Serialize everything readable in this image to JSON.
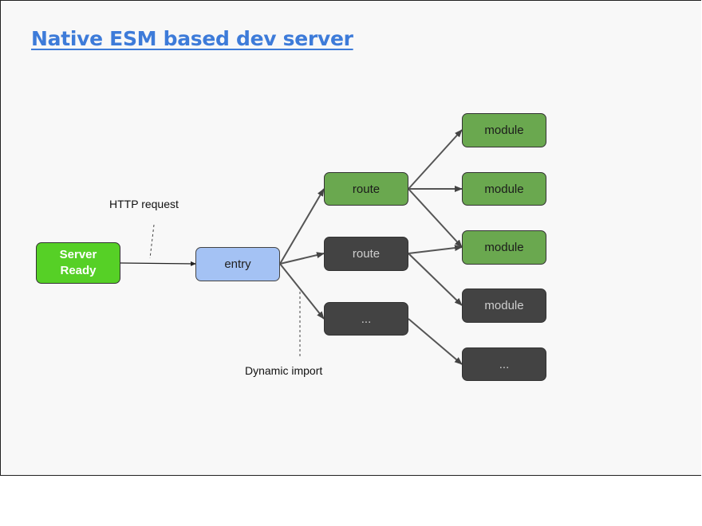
{
  "title": "Native ESM based dev server",
  "labels": {
    "http_request": "HTTP request",
    "dynamic_import": "Dynamic import"
  },
  "colors": {
    "title": "#3d7bd9",
    "server_ready": "#56d026",
    "entry": "#a4c2f4",
    "loaded": "#6aa84f",
    "not_loaded": "#434343",
    "background": "#f8f8f8"
  },
  "nodes": {
    "server_ready": "Server\nReady",
    "entry": "entry",
    "routes": [
      {
        "label": "route",
        "state": "loaded"
      },
      {
        "label": "route",
        "state": "not_loaded"
      },
      {
        "label": "...",
        "state": "not_loaded"
      }
    ],
    "modules": [
      {
        "label": "module",
        "state": "loaded"
      },
      {
        "label": "module",
        "state": "loaded"
      },
      {
        "label": "module",
        "state": "loaded"
      },
      {
        "label": "module",
        "state": "not_loaded"
      },
      {
        "label": "...",
        "state": "not_loaded"
      }
    ]
  },
  "edges": [
    [
      "server_ready",
      "entry"
    ],
    [
      "entry",
      "route_0"
    ],
    [
      "entry",
      "route_1"
    ],
    [
      "entry",
      "route_2"
    ],
    [
      "route_0",
      "module_0"
    ],
    [
      "route_0",
      "module_1"
    ],
    [
      "route_0",
      "module_2"
    ],
    [
      "route_1",
      "module_2"
    ],
    [
      "route_1",
      "module_3"
    ],
    [
      "route_2",
      "module_4"
    ]
  ]
}
